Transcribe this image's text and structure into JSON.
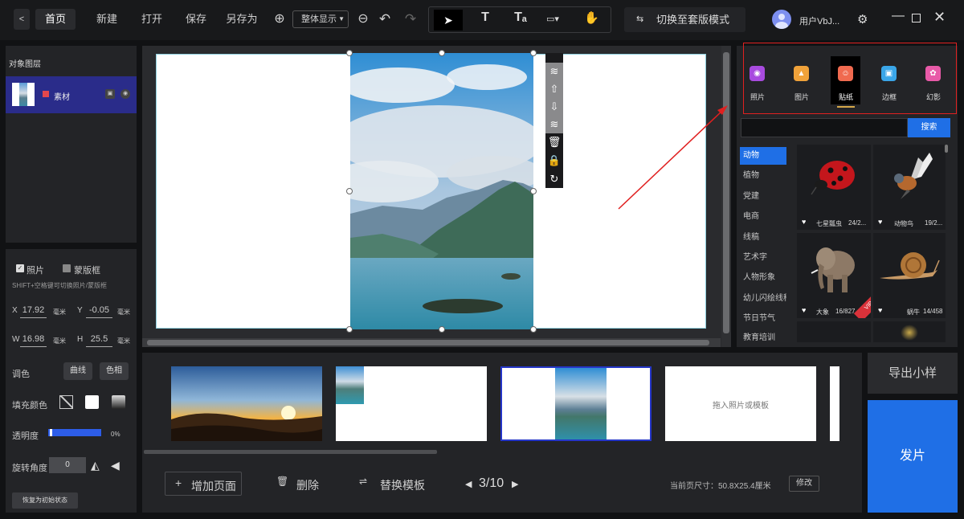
{
  "topbar": {
    "back": "<",
    "home": "首页",
    "new": "新建",
    "open": "打开",
    "save": "保存",
    "save_as": "另存为",
    "zoom_mode": "整体显示",
    "switch_mode": "切换至套版模式",
    "username": "用户VbJ..."
  },
  "left": {
    "layer_title": "对象图层",
    "layer_name": "素材",
    "chk_photo": "照片",
    "chk_frame": "蒙版框",
    "hint": "SHIFT+空格键可切换照片/蒙版框",
    "x_label": "X",
    "x_value": "17.92",
    "y_label": "Y",
    "y_value": "-0.05",
    "w_label": "W",
    "w_value": "16.98",
    "h_label": "H",
    "h_value": "25.5",
    "unit": "毫米",
    "tone_label": "调色",
    "curve_btn": "曲线",
    "hue_btn": "色相",
    "fill_label": "填充颜色",
    "opacity_label": "透明度",
    "opacity_value": "0%",
    "opacity_fraction": 0.03,
    "rotate_label": "旋转角度",
    "rotate_value": "0",
    "reset_btn": "恢复为初始状态"
  },
  "right": {
    "tabs": [
      {
        "label": "照片",
        "color": "#a84bdf"
      },
      {
        "label": "图片",
        "color": "#f0a23a"
      },
      {
        "label": "贴纸",
        "color": "#f06a4f"
      },
      {
        "label": "边框",
        "color": "#3aa6e8"
      },
      {
        "label": "幻影",
        "color": "#e85aa8"
      }
    ],
    "search_btn": "搜索",
    "categories": [
      "动物",
      "植物",
      "党建",
      "电商",
      "线稿",
      "艺术字",
      "人物形象",
      "幼儿闪绘线稿",
      "节日节气",
      "教育培训"
    ],
    "stickers": [
      {
        "name": "七星瓢虫",
        "count": "24/2..."
      },
      {
        "name": "动物鸟",
        "count": "19/2..."
      },
      {
        "name": "大象",
        "count": "16/827"
      },
      {
        "name": "蜗牛",
        "count": "14/458"
      }
    ],
    "vip_badge": "VIP"
  },
  "thumbs": {
    "empty_hint": "拖入照片或模板"
  },
  "bottom": {
    "add_page": "增加页面",
    "delete": "删除",
    "replace": "替换模板",
    "page_indicator": "3/10",
    "page_size": "当前页尺寸：50.8X25.4厘米",
    "modify": "修改",
    "export": "导出小样",
    "publish": "发片"
  },
  "colors": {
    "accent": "#1f6fe6",
    "highlight_box": "#e02020",
    "selected_layer": "#2a2c8a"
  }
}
